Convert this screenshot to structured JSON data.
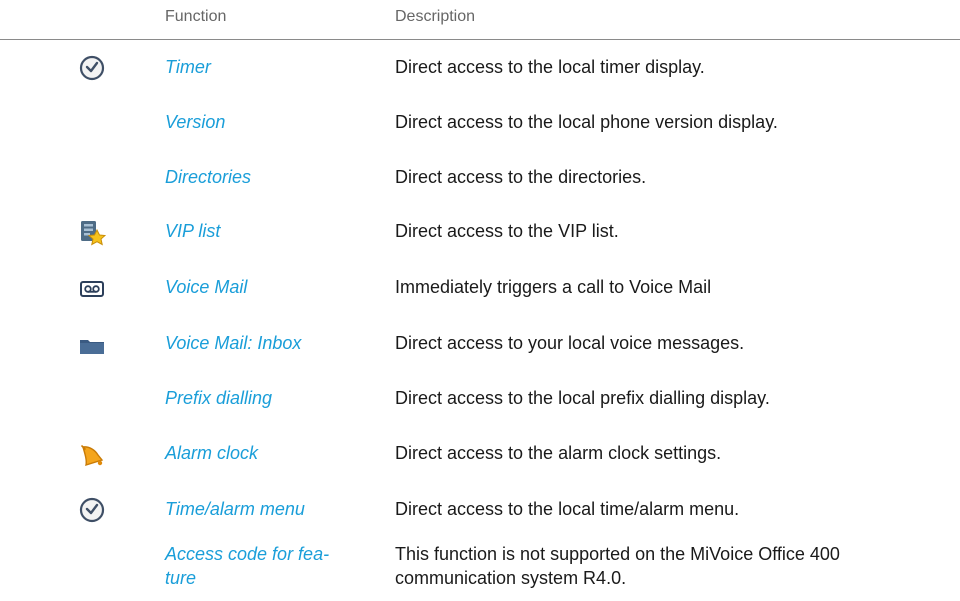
{
  "header": {
    "function": "Function",
    "description": "Description"
  },
  "rows": [
    {
      "icon": "clock-icon",
      "function": "Timer",
      "description": "Direct access to the local timer display."
    },
    {
      "icon": "",
      "function": "Version",
      "description": "Direct access to the local phone version display."
    },
    {
      "icon": "",
      "function": "Directories",
      "description": "Direct access to the directories."
    },
    {
      "icon": "vip-list-icon",
      "function": "VIP list",
      "description": "Direct access to the VIP list."
    },
    {
      "icon": "voicemail-icon",
      "function": "Voice Mail",
      "description": "Immediately triggers a call to Voice Mail"
    },
    {
      "icon": "folder-icon",
      "function": "Voice Mail: Inbox",
      "description": "Direct access to your local voice messages."
    },
    {
      "icon": "",
      "function": "Prefix dialling",
      "description": "Direct access to the local prefix dialling display."
    },
    {
      "icon": "bell-icon",
      "function": "Alarm clock",
      "description": "Direct access to the alarm clock settings."
    },
    {
      "icon": "clock-icon",
      "function": "Time/alarm menu",
      "description": "Direct access to the local time/alarm menu."
    },
    {
      "icon": "",
      "function": "Access code for fea-\nture",
      "description": "This function is not supported on the MiVoice Office 400\ncommunication system R4.0."
    }
  ]
}
